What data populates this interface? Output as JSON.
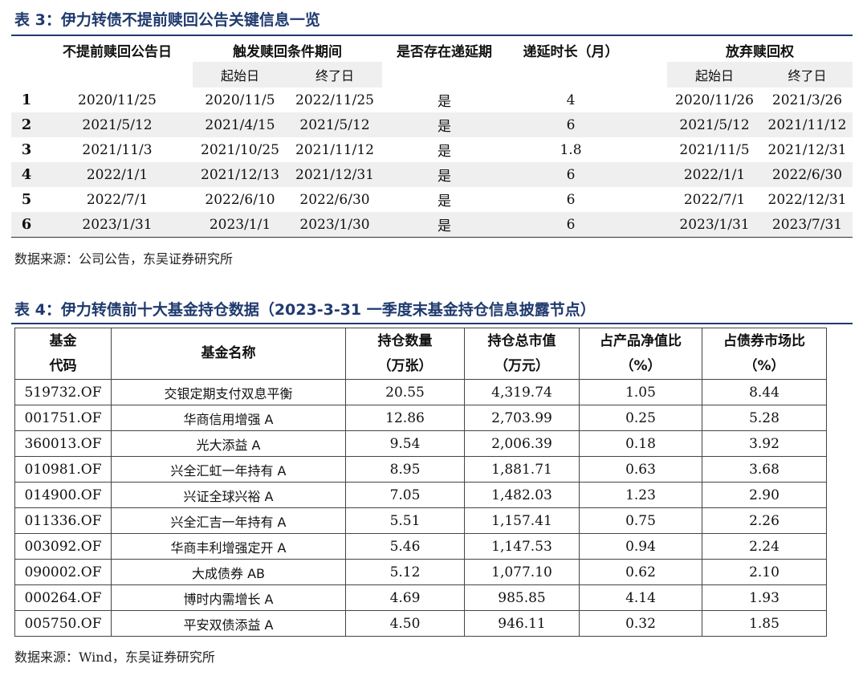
{
  "table3": {
    "title": "表 3：伊力转债不提前赎回公告关键信息一览",
    "headers": {
      "announce_date": "不提前赎回公告日",
      "trigger_period": "触发赎回条件期间",
      "has_extension": "是否存在递延期",
      "extension_length": "递延时长（月）",
      "waive_redemption": "放弃赎回权"
    },
    "subheaders": {
      "start": "起始日",
      "end": "终了日"
    },
    "rows": [
      {
        "idx": "1",
        "announce": "2020/11/25",
        "trig_start": "2020/11/5",
        "trig_end": "2022/11/25",
        "has_ext": "是",
        "ext_len": "4",
        "waive_start": "2020/11/26",
        "waive_end": "2021/3/26"
      },
      {
        "idx": "2",
        "announce": "2021/5/12",
        "trig_start": "2021/4/15",
        "trig_end": "2021/5/12",
        "has_ext": "是",
        "ext_len": "6",
        "waive_start": "2021/5/12",
        "waive_end": "2021/11/12"
      },
      {
        "idx": "3",
        "announce": "2021/11/3",
        "trig_start": "2021/10/25",
        "trig_end": "2021/11/12",
        "has_ext": "是",
        "ext_len": "1.8",
        "waive_start": "2021/11/5",
        "waive_end": "2021/12/31"
      },
      {
        "idx": "4",
        "announce": "2022/1/1",
        "trig_start": "2021/12/13",
        "trig_end": "2021/12/31",
        "has_ext": "是",
        "ext_len": "6",
        "waive_start": "2022/1/1",
        "waive_end": "2022/6/30"
      },
      {
        "idx": "5",
        "announce": "2022/7/1",
        "trig_start": "2022/6/10",
        "trig_end": "2022/6/30",
        "has_ext": "是",
        "ext_len": "6",
        "waive_start": "2022/7/1",
        "waive_end": "2022/12/31"
      },
      {
        "idx": "6",
        "announce": "2023/1/31",
        "trig_start": "2023/1/1",
        "trig_end": "2023/1/30",
        "has_ext": "是",
        "ext_len": "6",
        "waive_start": "2023/1/31",
        "waive_end": "2023/7/31"
      }
    ],
    "source": "数据来源：公司公告，东吴证券研究所"
  },
  "table4": {
    "title": "表 4：伊力转债前十大基金持仓数据（2023-3-31 一季度末基金持仓信息披露节点）",
    "headers": {
      "code_l1": "基金",
      "code_l2": "代码",
      "name": "基金名称",
      "qty_l1": "持仓数量",
      "qty_l2": "（万张）",
      "mv_l1": "持仓总市值",
      "mv_l2": "（万元）",
      "nav_l1": "占产品净值比",
      "nav_l2": "（%）",
      "mkt_l1": "占债券市场比",
      "mkt_l2": "（%）"
    },
    "rows": [
      {
        "code": "519732.OF",
        "name": "交银定期支付双息平衡",
        "qty": "20.55",
        "mv": "4,319.74",
        "nav": "1.05",
        "mkt": "8.44"
      },
      {
        "code": "001751.OF",
        "name": "华商信用增强 A",
        "qty": "12.86",
        "mv": "2,703.99",
        "nav": "0.25",
        "mkt": "5.28"
      },
      {
        "code": "360013.OF",
        "name": "光大添益 A",
        "qty": "9.54",
        "mv": "2,006.39",
        "nav": "0.18",
        "mkt": "3.92"
      },
      {
        "code": "010981.OF",
        "name": "兴全汇虹一年持有 A",
        "qty": "8.95",
        "mv": "1,881.71",
        "nav": "0.63",
        "mkt": "3.68"
      },
      {
        "code": "014900.OF",
        "name": "兴证全球兴裕 A",
        "qty": "7.05",
        "mv": "1,482.03",
        "nav": "1.23",
        "mkt": "2.90"
      },
      {
        "code": "011336.OF",
        "name": "兴全汇吉一年持有 A",
        "qty": "5.51",
        "mv": "1,157.41",
        "nav": "0.75",
        "mkt": "2.26"
      },
      {
        "code": "003092.OF",
        "name": "华商丰利增强定开 A",
        "qty": "5.46",
        "mv": "1,147.53",
        "nav": "0.94",
        "mkt": "2.24"
      },
      {
        "code": "090002.OF",
        "name": "大成债券 AB",
        "qty": "5.12",
        "mv": "1,077.10",
        "nav": "0.62",
        "mkt": "2.10"
      },
      {
        "code": "000264.OF",
        "name": "博时内需增长 A",
        "qty": "4.69",
        "mv": "985.85",
        "nav": "4.14",
        "mkt": "1.93"
      },
      {
        "code": "005750.OF",
        "name": "平安双债添益 A",
        "qty": "4.50",
        "mv": "946.11",
        "nav": "0.32",
        "mkt": "1.85"
      }
    ],
    "source": "数据来源：Wind，东吴证券研究所"
  },
  "colors": {
    "title": "#1f3a6e",
    "stripe": "#efefef",
    "rule": "#1f3a6e"
  }
}
